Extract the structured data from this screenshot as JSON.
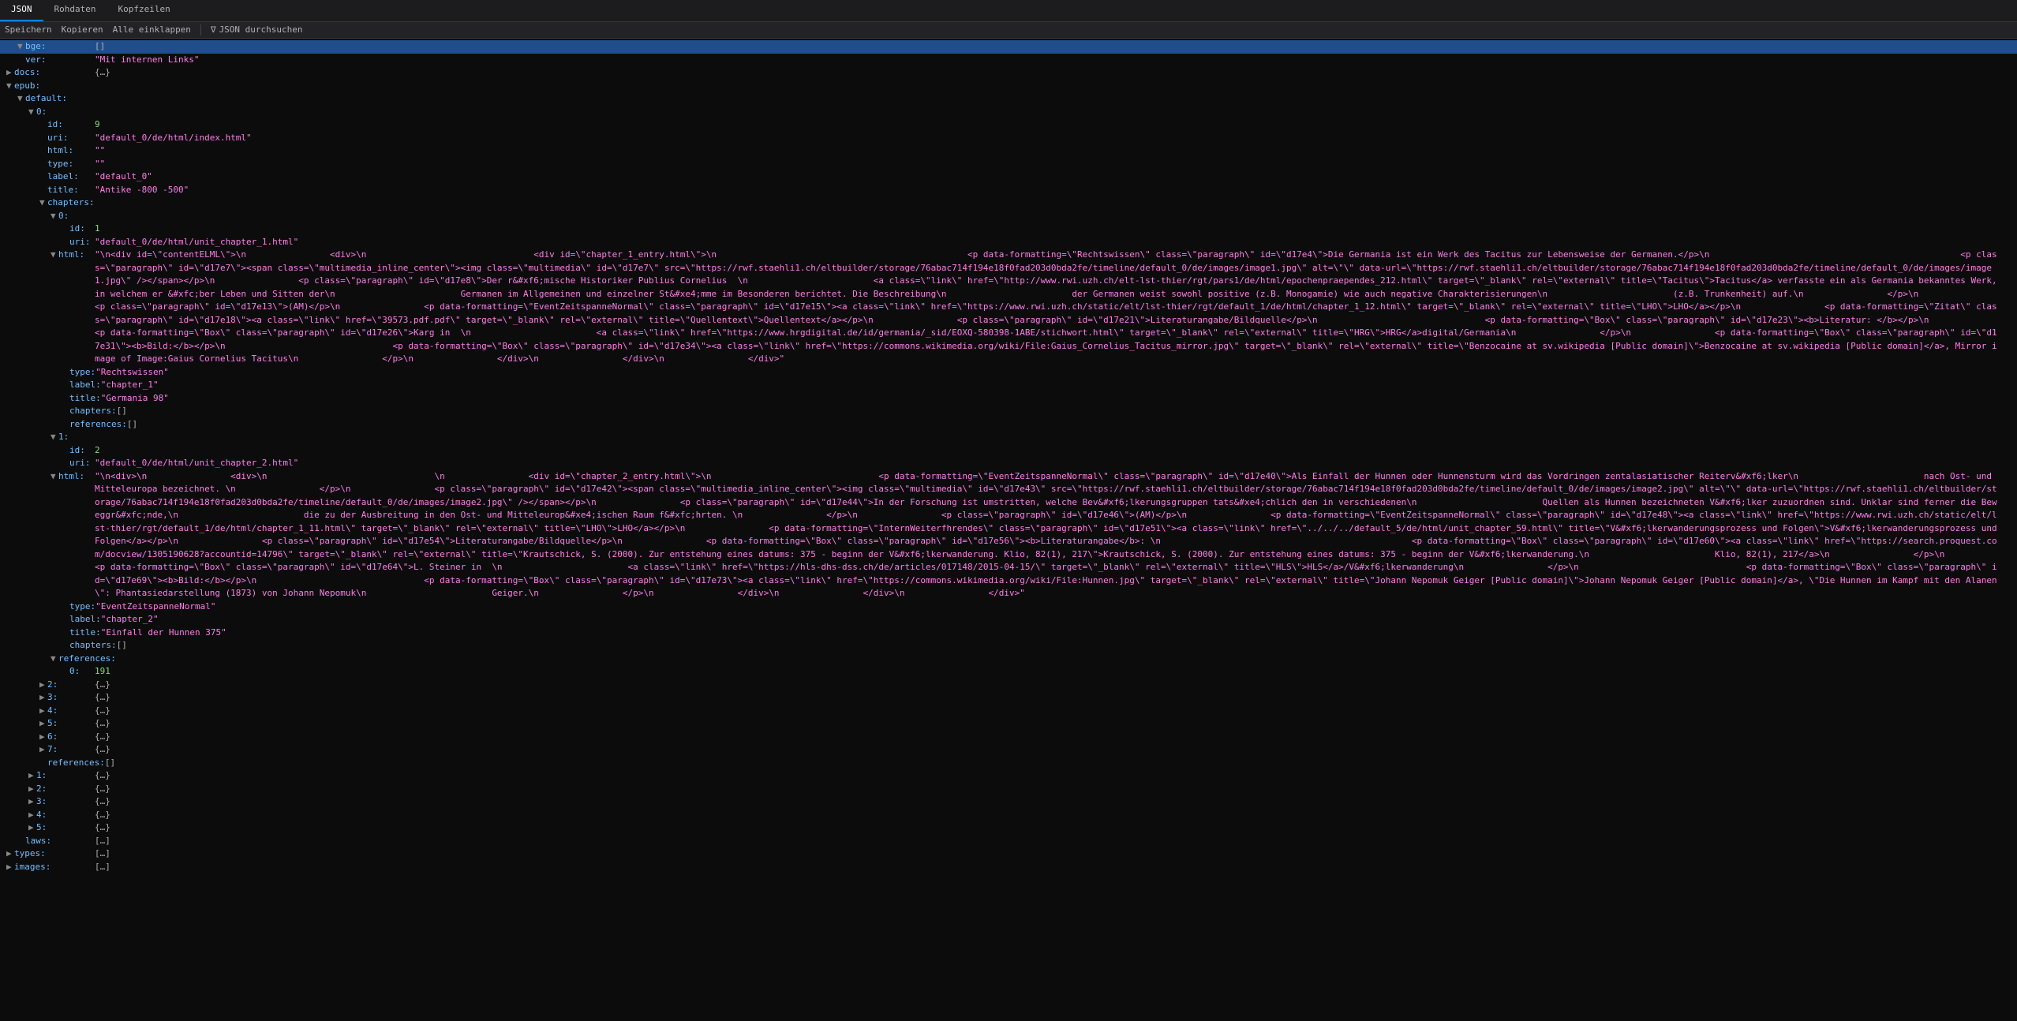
{
  "tabs": [
    "JSON",
    "Rohdaten",
    "Kopfzeilen"
  ],
  "activeTab": 0,
  "toolbar": {
    "save": "Speichern",
    "copy": "Kopieren",
    "collapse": "Alle einklappen",
    "filterIcon": "∇",
    "filterPlaceholder": "JSON durchsuchen"
  },
  "rows": [
    {
      "d": 1,
      "t": "e",
      "k": "bge:",
      "v": "[]",
      "vc": "obj",
      "hl": true
    },
    {
      "d": 1,
      "t": "l",
      "k": "ver:",
      "v": "\"Mit internen Links\"",
      "vc": "str"
    },
    {
      "d": 0,
      "t": "c",
      "k": "docs:",
      "v": "{…}",
      "vc": "obj"
    },
    {
      "d": 0,
      "t": "e",
      "k": "epub:",
      "v": "",
      "vc": ""
    },
    {
      "d": 1,
      "t": "e",
      "k": "default:",
      "v": "",
      "vc": ""
    },
    {
      "d": 2,
      "t": "e",
      "k": "0:",
      "v": "",
      "vc": ""
    },
    {
      "d": 3,
      "t": "l",
      "k": "id:",
      "v": "9",
      "vc": "num"
    },
    {
      "d": 3,
      "t": "l",
      "k": "uri:",
      "v": "\"default_0/de/html/index.html\"",
      "vc": "str"
    },
    {
      "d": 3,
      "t": "l",
      "k": "html:",
      "v": "\"\"",
      "vc": "str"
    },
    {
      "d": 3,
      "t": "l",
      "k": "type:",
      "v": "\"\"",
      "vc": "str"
    },
    {
      "d": 3,
      "t": "l",
      "k": "label:",
      "v": "\"default_0\"",
      "vc": "str"
    },
    {
      "d": 3,
      "t": "l",
      "k": "title:",
      "v": "\"Antike -800 -500\"",
      "vc": "str"
    },
    {
      "d": 3,
      "t": "e",
      "k": "chapters:",
      "v": "",
      "vc": ""
    },
    {
      "d": 4,
      "t": "e",
      "k": "0:",
      "v": "",
      "vc": ""
    },
    {
      "d": 5,
      "t": "l",
      "k": "id:",
      "v": "1",
      "vc": "num"
    },
    {
      "d": 5,
      "t": "l",
      "k": "uri:",
      "v": "\"default_0/de/html/unit_chapter_1.html\"",
      "vc": "str"
    },
    {
      "d": 4,
      "t": "e",
      "k": "html:",
      "v": "__HTML1__",
      "vc": "long"
    },
    {
      "d": 5,
      "t": "l",
      "k": "type:",
      "v": "\"Rechtswissen\"",
      "vc": "str"
    },
    {
      "d": 5,
      "t": "l",
      "k": "label:",
      "v": "\"chapter_1\"",
      "vc": "str"
    },
    {
      "d": 5,
      "t": "l",
      "k": "title:",
      "v": "\"Germania 98\"",
      "vc": "str"
    },
    {
      "d": 5,
      "t": "l",
      "k": "chapters:",
      "v": "[]",
      "vc": "obj"
    },
    {
      "d": 5,
      "t": "l",
      "k": "references:",
      "v": "[]",
      "vc": "obj"
    },
    {
      "d": 4,
      "t": "e",
      "k": "1:",
      "v": "",
      "vc": ""
    },
    {
      "d": 5,
      "t": "l",
      "k": "id:",
      "v": "2",
      "vc": "num"
    },
    {
      "d": 5,
      "t": "l",
      "k": "uri:",
      "v": "\"default_0/de/html/unit_chapter_2.html\"",
      "vc": "str"
    },
    {
      "d": 4,
      "t": "e",
      "k": "html:",
      "v": "__HTML2__",
      "vc": "long"
    },
    {
      "d": 5,
      "t": "l",
      "k": "type:",
      "v": "\"EventZeitspanneNormal\"",
      "vc": "str"
    },
    {
      "d": 5,
      "t": "l",
      "k": "label:",
      "v": "\"chapter_2\"",
      "vc": "str"
    },
    {
      "d": 5,
      "t": "l",
      "k": "title:",
      "v": "\"Einfall der Hunnen 375\"",
      "vc": "str"
    },
    {
      "d": 5,
      "t": "l",
      "k": "chapters:",
      "v": "[]",
      "vc": "obj"
    },
    {
      "d": 4,
      "t": "e",
      "k": "references:",
      "v": "",
      "vc": ""
    },
    {
      "d": 5,
      "t": "l",
      "k": "0:",
      "v": "191",
      "vc": "num"
    },
    {
      "d": 3,
      "t": "c",
      "k": "2:",
      "v": "{…}",
      "vc": "obj"
    },
    {
      "d": 3,
      "t": "c",
      "k": "3:",
      "v": "{…}",
      "vc": "obj"
    },
    {
      "d": 3,
      "t": "c",
      "k": "4:",
      "v": "{…}",
      "vc": "obj"
    },
    {
      "d": 3,
      "t": "c",
      "k": "5:",
      "v": "{…}",
      "vc": "obj"
    },
    {
      "d": 3,
      "t": "c",
      "k": "6:",
      "v": "{…}",
      "vc": "obj"
    },
    {
      "d": 3,
      "t": "c",
      "k": "7:",
      "v": "{…}",
      "vc": "obj"
    },
    {
      "d": 3,
      "t": "l",
      "k": "references:",
      "v": "[]",
      "vc": "obj"
    },
    {
      "d": 2,
      "t": "c",
      "k": "1:",
      "v": "{…}",
      "vc": "obj"
    },
    {
      "d": 2,
      "t": "c",
      "k": "2:",
      "v": "{…}",
      "vc": "obj"
    },
    {
      "d": 2,
      "t": "c",
      "k": "3:",
      "v": "{…}",
      "vc": "obj"
    },
    {
      "d": 2,
      "t": "c",
      "k": "4:",
      "v": "{…}",
      "vc": "obj"
    },
    {
      "d": 2,
      "t": "c",
      "k": "5:",
      "v": "{…}",
      "vc": "obj"
    },
    {
      "d": 1,
      "t": "l",
      "k": "laws:",
      "v": "[…]",
      "vc": "obj"
    },
    {
      "d": 0,
      "t": "c",
      "k": "types:",
      "v": "[…]",
      "vc": "obj"
    },
    {
      "d": 0,
      "t": "c",
      "k": "images:",
      "v": "[…]",
      "vc": "obj"
    }
  ],
  "html1": "\"\\n<div id=\\\"contentELML\\\">\\n                <div>\\n                                <div id=\\\"chapter_1_entry.html\\\">\\n                                                <p data-formatting=\\\"Rechtswissen\\\" class=\\\"paragraph\\\" id=\\\"d17e4\\\">Die Germania ist ein Werk des Tacitus zur Lebensweise der Germanen.</p>\\n                                                <p class=\\\"paragraph\\\" id=\\\"d17e7\\\"><span class=\\\"multimedia_inline_center\\\"><img class=\\\"multimedia\\\" id=\\\"d17e7\\\" src=\\\"https://rwf.staehli1.ch/eltbuilder/storage/76abac714f194e18f0fad203d0bda2fe/timeline/default_0/de/images/image1.jpg\\\" alt=\\\"\\\" data-url=\\\"https://rwf.staehli1.ch/eltbuilder/storage/76abac714f194e18f0fad203d0bda2fe/timeline/default_0/de/images/image1.jpg\\\" /></span></p>\\n                <p class=\\\"paragraph\\\" id=\\\"d17e8\\\">Der r&#xf6;mische Historiker Publius Cornelius  \\n                        <a class=\\\"link\\\" href=\\\"http://www.rwi.uzh.ch/elt-lst-thier/rgt/pars1/de/html/epochenpraependes_212.html\\\" target=\\\"_blank\\\" rel=\\\"external\\\" title=\\\"Tacitus\\\">Tacitus</a> verfasste ein als Germania bekanntes Werk, in welchem er &#xfc;ber Leben und Sitten der\\n                        Germanen im Allgemeinen und einzelner St&#xe4;mme im Besonderen berichtet. Die Beschreibung\\n                        der Germanen weist sowohl positive (z.B. Monogamie) wie auch negative Charakterisierungen\\n                        (z.B. Trunkenheit) auf.\\n                </p>\\n                <p class=\\\"paragraph\\\" id=\\\"d17e13\\\">(AM)</p>\\n                <p data-formatting=\\\"EventZeitspanneNormal\\\" class=\\\"paragraph\\\" id=\\\"d17e15\\\"><a class=\\\"link\\\" href=\\\"https://www.rwi.uzh.ch/static/elt/lst-thier/rgt/default_1/de/html/chapter_1_12.html\\\" target=\\\"_blank\\\" rel=\\\"external\\\" title=\\\"LHO\\\">LHO</a></p>\\n                <p data-formatting=\\\"Zitat\\\" class=\\\"paragraph\\\" id=\\\"d17e18\\\"><a class=\\\"link\\\" href=\\\"39573.pdf.pdf\\\" target=\\\"_blank\\\" rel=\\\"external\\\" title=\\\"Quellentext\\\">Quellentext</a></p>\\n                <p class=\\\"paragraph\\\" id=\\\"d17e21\\\">Literaturangabe/Bildquelle</p>\\n                                <p data-formatting=\\\"Box\\\" class=\\\"paragraph\\\" id=\\\"d17e23\\\"><b>Literatur: </b></p>\\n                                                <p data-formatting=\\\"Box\\\" class=\\\"paragraph\\\" id=\\\"d17e26\\\">Karg in  \\n                        <a class=\\\"link\\\" href=\\\"https://www.hrgdigital.de/id/germania/_sid/EOXQ-580398-1ABE/stichwort.html\\\" target=\\\"_blank\\\" rel=\\\"external\\\" title=\\\"HRG\\\">HRG</a>digital/Germania\\n                </p>\\n                <p data-formatting=\\\"Box\\\" class=\\\"paragraph\\\" id=\\\"d17e31\\\"><b>Bild:</b></p>\\n                                <p data-formatting=\\\"Box\\\" class=\\\"paragraph\\\" id=\\\"d17e34\\\"><a class=\\\"link\\\" href=\\\"https://commons.wikimedia.org/wiki/File:Gaius_Cornelius_Tacitus_mirror.jpg\\\" target=\\\"_blank\\\" rel=\\\"external\\\" title=\\\"Benzocaine at sv.wikipedia [Public domain]\\\">Benzocaine at sv.wikipedia [Public domain]</a>, Mirror image of Image:Gaius Cornelius Tacitus\\n                </p>\\n                </div>\\n                </div>\\n                </div>\"",
  "html2": "\"\\n<div>\\n                <div>\\n                                \\n                <div id=\\\"chapter_2_entry.html\\\">\\n                                <p data-formatting=\\\"EventZeitspanneNormal\\\" class=\\\"paragraph\\\" id=\\\"d17e40\\\">Als Einfall der Hunnen oder Hunnensturm wird das Vordringen zentalasiatischer Reiterv&#xf6;lker\\n                        nach Ost- und Mitteleuropa bezeichnet. \\n                </p>\\n                <p class=\\\"paragraph\\\" id=\\\"d17e42\\\"><span class=\\\"multimedia_inline_center\\\"><img class=\\\"multimedia\\\" id=\\\"d17e43\\\" src=\\\"https://rwf.staehli1.ch/eltbuilder/storage/76abac714f194e18f0fad203d0bda2fe/timeline/default_0/de/images/image2.jpg\\\" alt=\\\"\\\" data-url=\\\"https://rwf.staehli1.ch/eltbuilder/storage/76abac714f194e18f0fad203d0bda2fe/timeline/default_0/de/images/image2.jpg\\\" /></span></p>\\n                <p class=\\\"paragraph\\\" id=\\\"d17e44\\\">In der Forschung ist umstritten, welche Bev&#xf6;lkerungsgruppen tats&#xe4;chlich den in verschiedenen\\n                        Quellen als Hunnen bezeichneten V&#xf6;lker zuzuordnen sind. Unklar sind ferner die Beweggr&#xfc;nde,\\n                        die zu der Ausbreitung in den Ost- und Mitteleurop&#xe4;ischen Raum f&#xfc;hrten. \\n                </p>\\n                <p class=\\\"paragraph\\\" id=\\\"d17e46\\\">(AM)</p>\\n                <p data-formatting=\\\"EventZeitspanneNormal\\\" class=\\\"paragraph\\\" id=\\\"d17e48\\\"><a class=\\\"link\\\" href=\\\"https://www.rwi.uzh.ch/static/elt/lst-thier/rgt/default_1/de/html/chapter_1_11.html\\\" target=\\\"_blank\\\" rel=\\\"external\\\" title=\\\"LHO\\\">LHO</a></p>\\n                <p data-formatting=\\\"InternWeiterfhrendes\\\" class=\\\"paragraph\\\" id=\\\"d17e51\\\"><a class=\\\"link\\\" href=\\\"../../../default_5/de/html/unit_chapter_59.html\\\" title=\\\"V&#xf6;lkerwanderungsprozess und Folgen\\\">V&#xf6;lkerwanderungsprozess und Folgen</a></p>\\n                <p class=\\\"paragraph\\\" id=\\\"d17e54\\\">Literaturangabe/Bildquelle</p>\\n                <p data-formatting=\\\"Box\\\" class=\\\"paragraph\\\" id=\\\"d17e56\\\"><b>Literaturangabe</b>: \\n                                                <p data-formatting=\\\"Box\\\" class=\\\"paragraph\\\" id=\\\"d17e60\\\"><a class=\\\"link\\\" href=\\\"https://search.proquest.com/docview/1305190628?accountid=14796\\\" target=\\\"_blank\\\" rel=\\\"external\\\" title=\\\"Krautschick, S. (2000). Zur entstehung eines datums: 375 - beginn der V&#xf6;lkerwanderung. Klio, 82(1), 217\\\">Krautschick, S. (2000). Zur entstehung eines datums: 375 - beginn der V&#xf6;lkerwanderung.\\n                        Klio, 82(1), 217</a>\\n                </p>\\n                <p data-formatting=\\\"Box\\\" class=\\\"paragraph\\\" id=\\\"d17e64\\\">L. Steiner in  \\n                        <a class=\\\"link\\\" href=\\\"https://hls-dhs-dss.ch/de/articles/017148/2015-04-15/\\\" target=\\\"_blank\\\" rel=\\\"external\\\" title=\\\"HLS\\\">HLS</a>/V&#xf6;lkerwanderung\\n                </p>\\n                                <p data-formatting=\\\"Box\\\" class=\\\"paragraph\\\" id=\\\"d17e69\\\"><b>Bild:</b></p>\\n                                <p data-formatting=\\\"Box\\\" class=\\\"paragraph\\\" id=\\\"d17e73\\\"><a class=\\\"link\\\" href=\\\"https://commons.wikimedia.org/wiki/File:Hunnen.jpg\\\" target=\\\"_blank\\\" rel=\\\"external\\\" title=\\\"Johann Nepomuk Geiger [Public domain]\\\">Johann Nepomuk Geiger [Public domain]</a>, \\\"Die Hunnen im Kampf mit den Alanen\\\": Phantasiedarstellung (1873) von Johann Nepomuk\\n                        Geiger.\\n                </p>\\n                </div>\\n                </div>\\n                </div>\""
}
